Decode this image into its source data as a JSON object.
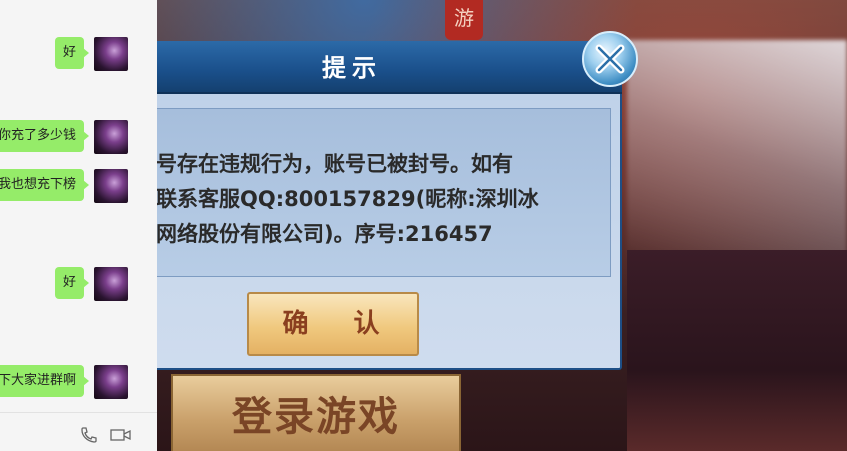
{
  "chat": {
    "messages": [
      {
        "text": "好"
      },
      {
        "text": "你充了多少钱"
      },
      {
        "text": "我也想充下榜"
      },
      {
        "text": "好"
      },
      {
        "text": "拉下大家进群啊"
      }
    ],
    "toolbar": {
      "icons": [
        "phone-icon",
        "video-call-icon"
      ]
    }
  },
  "game": {
    "seal_text": "游",
    "login_button": "登录游戏"
  },
  "dialog": {
    "title": "提示",
    "message_lines": [
      "号存在违规行为，账号已被封号。如有",
      "联系客服QQ:800157829(昵称:深圳冰",
      "网络股份有限公司)。序号:216457"
    ],
    "confirm_label": "确 认",
    "close_icon": "close-icon"
  }
}
